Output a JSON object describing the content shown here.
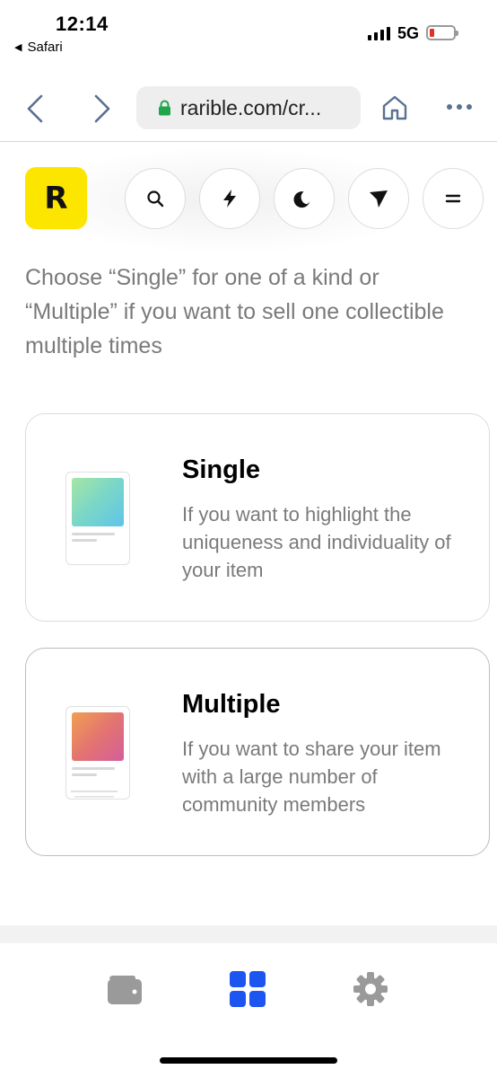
{
  "status_bar": {
    "time": "12:14",
    "back_app": "Safari",
    "network": "5G",
    "battery_color": "#e0302a"
  },
  "browser": {
    "url": "rarible.com/cr...",
    "icons": [
      "chevron-left-icon",
      "chevron-right-icon",
      "lock-icon",
      "home-icon",
      "more-icon"
    ]
  },
  "header": {
    "logo_letter": "R",
    "logo_color": "#fce600",
    "buttons": [
      "search-icon",
      "bolt-icon",
      "moon-icon",
      "send-icon",
      "menu-icon"
    ]
  },
  "intro": {
    "text": "Choose “Single” for one of a kind or “Multiple” if you want to sell one collectible multiple times"
  },
  "options": [
    {
      "title": "Single",
      "description": "If you want to highlight the uniqueness and individuality of your item"
    },
    {
      "title": "Multiple",
      "description": "If you want to share your item with a large number of community members"
    }
  ],
  "bottom_nav": {
    "items": [
      "wallet-icon",
      "grid-icon",
      "gear-icon"
    ],
    "active": "grid-icon",
    "active_color": "#1d55f0",
    "inactive_color": "#9a9a9a"
  }
}
